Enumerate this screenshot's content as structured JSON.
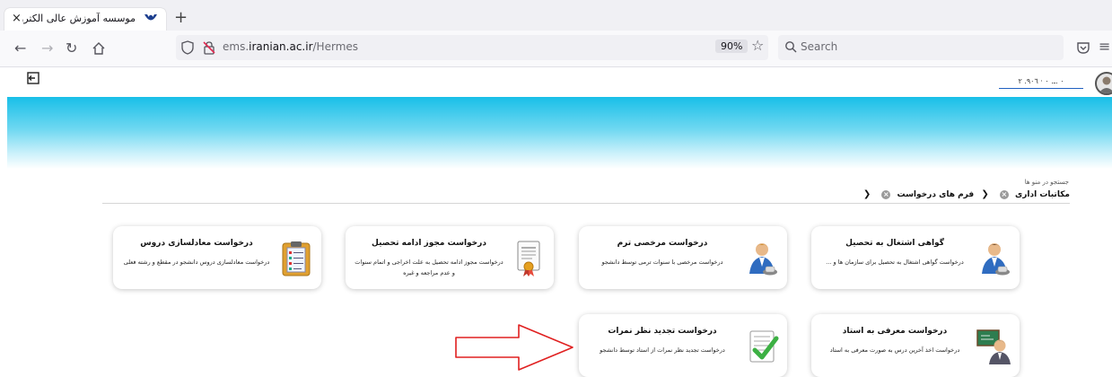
{
  "browser": {
    "tab_title": "موسسه آموزش عالی الکترونیکی ا...",
    "tab_close": "×",
    "new_tab": "+",
    "url_host": "ems.",
    "url_domain": "iranian.ac.ir",
    "url_path": "/Hermes",
    "zoom": "90%",
    "search_placeholder": "Search"
  },
  "header": {
    "user_name": "٠ .ـ. ٠ · ٩٠٦. ٢",
    "banner_colors": [
      "#19bfe8",
      "#cff2fb"
    ]
  },
  "breadcrumb": {
    "menu_search_label": "جستجو در منو ها",
    "items": [
      "مکاتبات اداری",
      "فرم های درخواست"
    ]
  },
  "cards": [
    {
      "title": "گواهی اشتغال به تحصیل",
      "desc": "درخواست گواهی اشتغال به تحصیل برای سازمان ها و ...",
      "icon": "person-icon"
    },
    {
      "title": "درخواست مرخصی ترم",
      "desc": "درخواست مرخصی با سنوات ترمی توسط دانشجو",
      "icon": "person-icon"
    },
    {
      "title": "درخواست مجوز ادامه تحصیل",
      "desc": "درخواست مجوز ادامه تحصیل به علت اخراجی و اتمام سنوات و عدم مراجعه و غیره",
      "icon": "certificate-icon"
    },
    {
      "title": "درخواست معادلسازی دروس",
      "desc": "درخواست معادلسازی دروس دانشجو در مقطع و رشته فعلی",
      "icon": "clipboard-icon"
    },
    {
      "title": "درخواست معرفی به استاد",
      "desc": "درخواست اخذ آخرین درس به صورت معرفی به استاد",
      "icon": "teacher-icon"
    },
    {
      "title": "درخواست تجدید نظر نمرات",
      "desc": "درخواست تجدید نظر نمرات از استاد توسط دانشجو",
      "icon": "checklist-icon"
    }
  ]
}
